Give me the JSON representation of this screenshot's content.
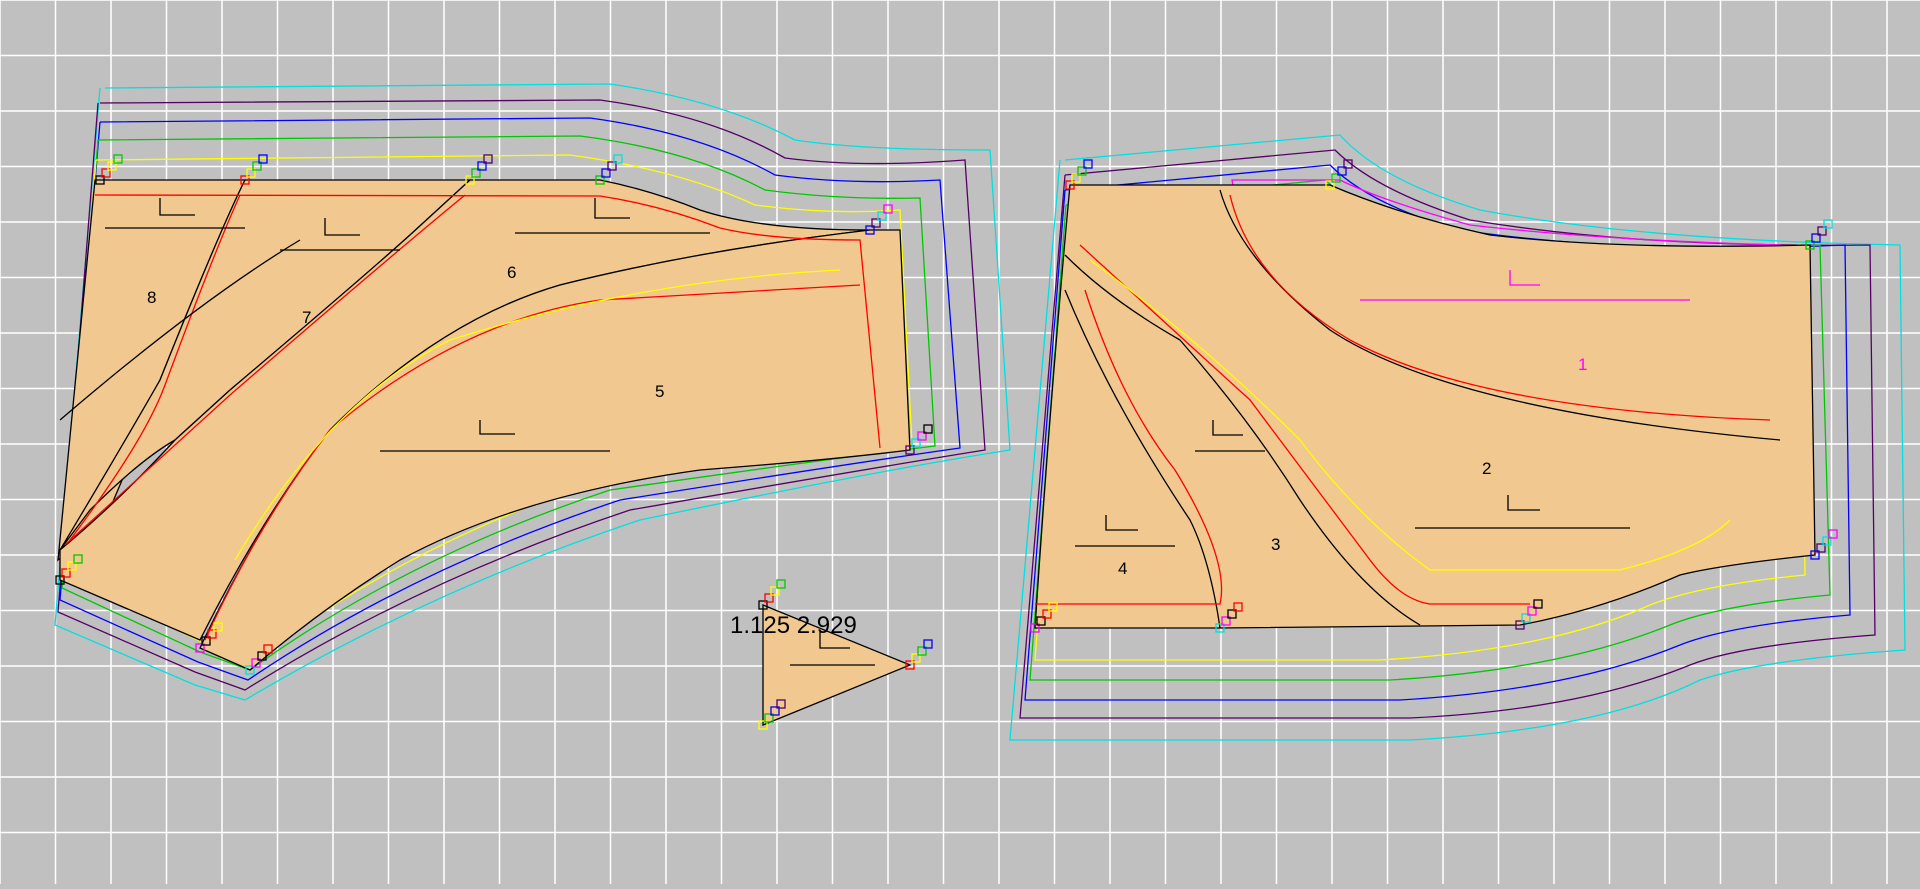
{
  "view": {
    "background": "#c0c0c0",
    "grid_color": "#ffffff",
    "piece_fill": "#f0c890"
  },
  "size_colors": [
    "#000000",
    "#ff0000",
    "#ffff00",
    "#00c800",
    "#0000ff",
    "#550066",
    "#00e0e0",
    "#ff00ff"
  ],
  "pieces": {
    "p1": {
      "label": "1",
      "label_color": "#ff00ff"
    },
    "p2": {
      "label": "2"
    },
    "p3": {
      "label": "3"
    },
    "p4": {
      "label": "4"
    },
    "p5": {
      "label": "5"
    },
    "p6": {
      "label": "6"
    },
    "p7": {
      "label": "7"
    },
    "p8": {
      "label": "8"
    }
  },
  "readout": {
    "text": "1.125 2.929"
  }
}
